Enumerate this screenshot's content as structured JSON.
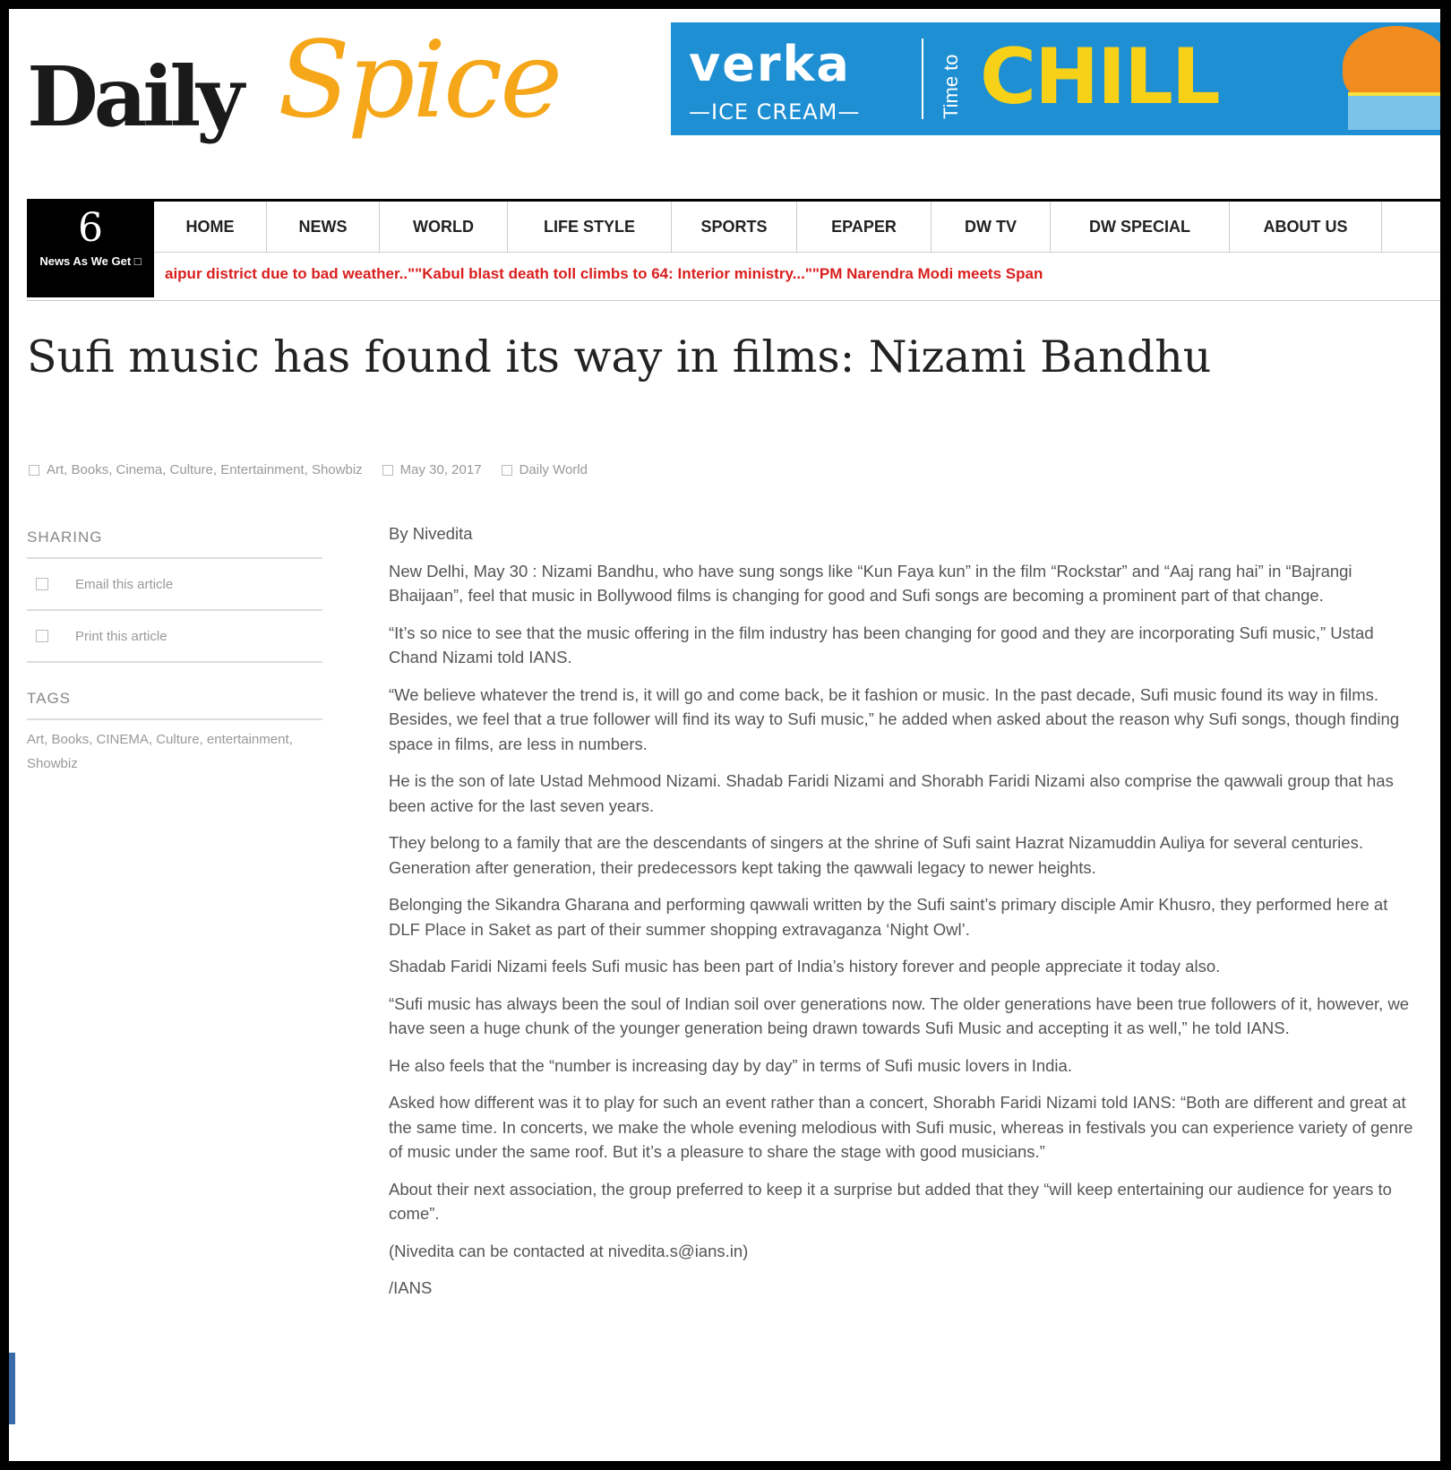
{
  "logo": {
    "daily": "Daily",
    "spice": "Spice"
  },
  "ad": {
    "brand": "verka",
    "sub": "—ICE CREAM—",
    "tagline": "Time to",
    "headline": "CHILL"
  },
  "badge": {
    "number": "6",
    "label": "News As We Get □"
  },
  "nav": [
    "HOME",
    "NEWS",
    "WORLD",
    "LIFE STYLE",
    "SPORTS",
    "EPAPER",
    "DW TV",
    "DW SPECIAL",
    "ABOUT US"
  ],
  "ticker": "aipur district due to bad weather..\"\"Kabul blast death toll climbs to 64: Interior ministry...\"\"PM Narendra Modi meets Span",
  "article": {
    "title": "Sufi music has found its way in films: Nizami Bandhu",
    "categories": "Art, Books, Cinema, Culture, Entertainment, Showbiz",
    "date": "May 30, 2017",
    "author": "Daily World",
    "paragraphs": [
      "By Nivedita",
      "New Delhi, May 30 : Nizami Bandhu, who have sung songs like “Kun Faya kun” in the film “Rockstar” and “Aaj rang hai” in “Bajrangi Bhaijaan”, feel that music in Bollywood films is changing for good and Sufi songs are becoming a prominent part of that change.",
      "“It’s so nice to see that the music offering in the film industry has been changing for good and they are incorporating Sufi music,” Ustad Chand Nizami told IANS.",
      "“We believe whatever the trend is, it will go and come back, be it fashion or music. In the past decade, Sufi music found its way in films. Besides, we feel that a true follower will find its way to Sufi music,” he added when asked about the reason why Sufi songs, though finding space in films, are less in numbers.",
      "He is the son of late Ustad Mehmood Nizami. Shadab Faridi Nizami and Shorabh Faridi Nizami also comprise the qawwali group that has been active for the last seven years.",
      "They belong to a family that are the descendants of singers at the shrine of Sufi saint Hazrat Nizamuddin Auliya for several centuries. Generation after generation, their predecessors kept taking the qawwali legacy to newer heights.",
      "Belonging the Sikandra Gharana and performing qawwali written by the Sufi saint’s primary disciple Amir Khusro, they performed here at DLF Place in Saket as part of their summer shopping extravaganza ‘Night Owl’.",
      "Shadab Faridi Nizami feels Sufi music has been part of India’s history forever and people appreciate it today also.",
      "“Sufi music has always been the soul of Indian soil over generations now. The older generations have been true followers of it, however, we have seen a huge chunk of the younger generation being drawn towards Sufi Music and accepting it as well,” he told IANS.",
      "He also feels that the “number is increasing day by day” in terms of Sufi music lovers in India.",
      "Asked how different was it to play for such an event rather than a concert, Shorabh Faridi Nizami told IANS: “Both are different and great at the same time. In concerts, we make the whole evening melodious with Sufi music, whereas in festivals you can experience variety of genre of music under the same roof. But it’s a pleasure to share the stage with good musicians.”",
      "About their next association, the group preferred to keep it a surprise but added that they “will keep entertaining our audience for years to come”.",
      "(Nivedita can be contacted at nivedita.s@ians.in)",
      "/IANS"
    ]
  },
  "sidebar": {
    "sharing_head": "SHARING",
    "email": "Email this article",
    "print": "Print this article",
    "tags_head": "TAGS",
    "tags": "Art, Books, CINEMA, Culture, entertainment, Showbiz"
  },
  "colors": {
    "brand_yellow": "#f5a719",
    "ad_blue": "#1e8fd3",
    "ticker_red": "#d9201f"
  }
}
